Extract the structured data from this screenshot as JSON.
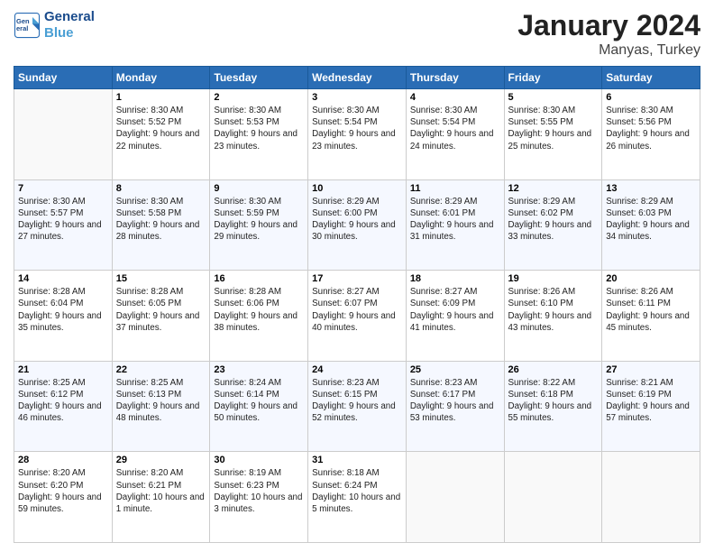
{
  "header": {
    "logo_line1": "General",
    "logo_line2": "Blue",
    "title": "January 2024",
    "subtitle": "Manyas, Turkey"
  },
  "days_of_week": [
    "Sunday",
    "Monday",
    "Tuesday",
    "Wednesday",
    "Thursday",
    "Friday",
    "Saturday"
  ],
  "weeks": [
    [
      {
        "day": "",
        "sunrise": "",
        "sunset": "",
        "daylight": ""
      },
      {
        "day": "1",
        "sunrise": "8:30 AM",
        "sunset": "5:52 PM",
        "daylight": "9 hours and 22 minutes."
      },
      {
        "day": "2",
        "sunrise": "8:30 AM",
        "sunset": "5:53 PM",
        "daylight": "9 hours and 23 minutes."
      },
      {
        "day": "3",
        "sunrise": "8:30 AM",
        "sunset": "5:54 PM",
        "daylight": "9 hours and 23 minutes."
      },
      {
        "day": "4",
        "sunrise": "8:30 AM",
        "sunset": "5:54 PM",
        "daylight": "9 hours and 24 minutes."
      },
      {
        "day": "5",
        "sunrise": "8:30 AM",
        "sunset": "5:55 PM",
        "daylight": "9 hours and 25 minutes."
      },
      {
        "day": "6",
        "sunrise": "8:30 AM",
        "sunset": "5:56 PM",
        "daylight": "9 hours and 26 minutes."
      }
    ],
    [
      {
        "day": "7",
        "sunrise": "8:30 AM",
        "sunset": "5:57 PM",
        "daylight": "9 hours and 27 minutes."
      },
      {
        "day": "8",
        "sunrise": "8:30 AM",
        "sunset": "5:58 PM",
        "daylight": "9 hours and 28 minutes."
      },
      {
        "day": "9",
        "sunrise": "8:30 AM",
        "sunset": "5:59 PM",
        "daylight": "9 hours and 29 minutes."
      },
      {
        "day": "10",
        "sunrise": "8:29 AM",
        "sunset": "6:00 PM",
        "daylight": "9 hours and 30 minutes."
      },
      {
        "day": "11",
        "sunrise": "8:29 AM",
        "sunset": "6:01 PM",
        "daylight": "9 hours and 31 minutes."
      },
      {
        "day": "12",
        "sunrise": "8:29 AM",
        "sunset": "6:02 PM",
        "daylight": "9 hours and 33 minutes."
      },
      {
        "day": "13",
        "sunrise": "8:29 AM",
        "sunset": "6:03 PM",
        "daylight": "9 hours and 34 minutes."
      }
    ],
    [
      {
        "day": "14",
        "sunrise": "8:28 AM",
        "sunset": "6:04 PM",
        "daylight": "9 hours and 35 minutes."
      },
      {
        "day": "15",
        "sunrise": "8:28 AM",
        "sunset": "6:05 PM",
        "daylight": "9 hours and 37 minutes."
      },
      {
        "day": "16",
        "sunrise": "8:28 AM",
        "sunset": "6:06 PM",
        "daylight": "9 hours and 38 minutes."
      },
      {
        "day": "17",
        "sunrise": "8:27 AM",
        "sunset": "6:07 PM",
        "daylight": "9 hours and 40 minutes."
      },
      {
        "day": "18",
        "sunrise": "8:27 AM",
        "sunset": "6:09 PM",
        "daylight": "9 hours and 41 minutes."
      },
      {
        "day": "19",
        "sunrise": "8:26 AM",
        "sunset": "6:10 PM",
        "daylight": "9 hours and 43 minutes."
      },
      {
        "day": "20",
        "sunrise": "8:26 AM",
        "sunset": "6:11 PM",
        "daylight": "9 hours and 45 minutes."
      }
    ],
    [
      {
        "day": "21",
        "sunrise": "8:25 AM",
        "sunset": "6:12 PM",
        "daylight": "9 hours and 46 minutes."
      },
      {
        "day": "22",
        "sunrise": "8:25 AM",
        "sunset": "6:13 PM",
        "daylight": "9 hours and 48 minutes."
      },
      {
        "day": "23",
        "sunrise": "8:24 AM",
        "sunset": "6:14 PM",
        "daylight": "9 hours and 50 minutes."
      },
      {
        "day": "24",
        "sunrise": "8:23 AM",
        "sunset": "6:15 PM",
        "daylight": "9 hours and 52 minutes."
      },
      {
        "day": "25",
        "sunrise": "8:23 AM",
        "sunset": "6:17 PM",
        "daylight": "9 hours and 53 minutes."
      },
      {
        "day": "26",
        "sunrise": "8:22 AM",
        "sunset": "6:18 PM",
        "daylight": "9 hours and 55 minutes."
      },
      {
        "day": "27",
        "sunrise": "8:21 AM",
        "sunset": "6:19 PM",
        "daylight": "9 hours and 57 minutes."
      }
    ],
    [
      {
        "day": "28",
        "sunrise": "8:20 AM",
        "sunset": "6:20 PM",
        "daylight": "9 hours and 59 minutes."
      },
      {
        "day": "29",
        "sunrise": "8:20 AM",
        "sunset": "6:21 PM",
        "daylight": "10 hours and 1 minute."
      },
      {
        "day": "30",
        "sunrise": "8:19 AM",
        "sunset": "6:23 PM",
        "daylight": "10 hours and 3 minutes."
      },
      {
        "day": "31",
        "sunrise": "8:18 AM",
        "sunset": "6:24 PM",
        "daylight": "10 hours and 5 minutes."
      },
      {
        "day": "",
        "sunrise": "",
        "sunset": "",
        "daylight": ""
      },
      {
        "day": "",
        "sunrise": "",
        "sunset": "",
        "daylight": ""
      },
      {
        "day": "",
        "sunrise": "",
        "sunset": "",
        "daylight": ""
      }
    ]
  ],
  "labels": {
    "sunrise": "Sunrise:",
    "sunset": "Sunset:",
    "daylight": "Daylight:"
  }
}
